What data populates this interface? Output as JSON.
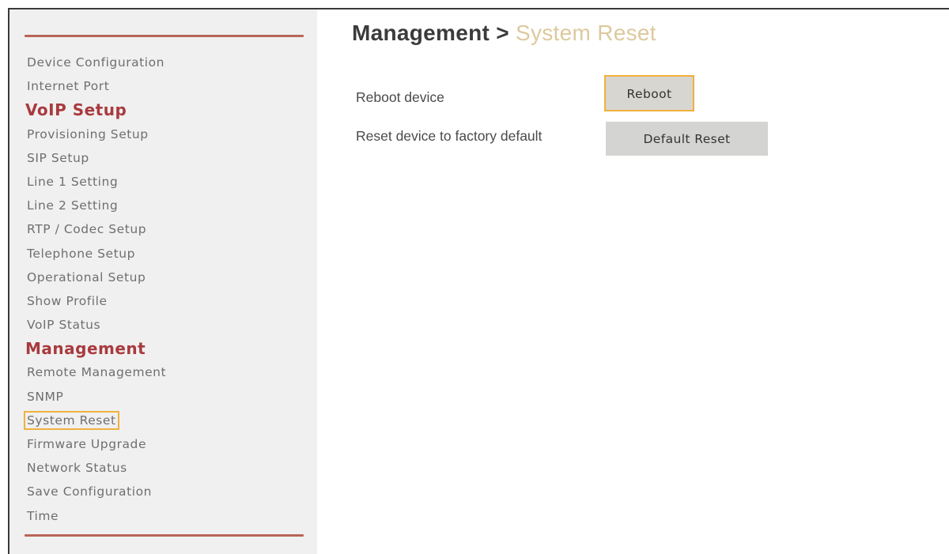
{
  "sidebar": {
    "items": [
      {
        "type": "item",
        "label": "Device Configuration"
      },
      {
        "type": "item",
        "label": "Internet Port"
      },
      {
        "type": "section",
        "label": "VoIP Setup"
      },
      {
        "type": "item",
        "label": "Provisioning Setup"
      },
      {
        "type": "item",
        "label": "SIP Setup"
      },
      {
        "type": "item",
        "label": "Line 1 Setting"
      },
      {
        "type": "item",
        "label": "Line 2 Setting"
      },
      {
        "type": "item",
        "label": "RTP / Codec Setup"
      },
      {
        "type": "item",
        "label": "Telephone Setup"
      },
      {
        "type": "item",
        "label": "Operational Setup"
      },
      {
        "type": "item",
        "label": "Show Profile"
      },
      {
        "type": "item",
        "label": "VoIP Status"
      },
      {
        "type": "section",
        "label": "Management"
      },
      {
        "type": "item",
        "label": "Remote Management"
      },
      {
        "type": "item",
        "label": "SNMP"
      },
      {
        "type": "item",
        "label": "System Reset",
        "active": true
      },
      {
        "type": "item",
        "label": "Firmware Upgrade"
      },
      {
        "type": "item",
        "label": "Network Status"
      },
      {
        "type": "item",
        "label": "Save Configuration"
      },
      {
        "type": "item",
        "label": "Time"
      }
    ]
  },
  "header": {
    "section": "Management",
    "separator": " > ",
    "current": "System Reset"
  },
  "main": {
    "reboot": {
      "label": "Reboot device",
      "button": "Reboot"
    },
    "reset": {
      "label": "Reset device to factory default",
      "button": "Default Reset"
    }
  },
  "colors": {
    "section_heading": "#a83a3e",
    "highlight_outline": "#f0b13f",
    "sidebar_rule": "#b86556",
    "title_current": "#ddc99e"
  }
}
